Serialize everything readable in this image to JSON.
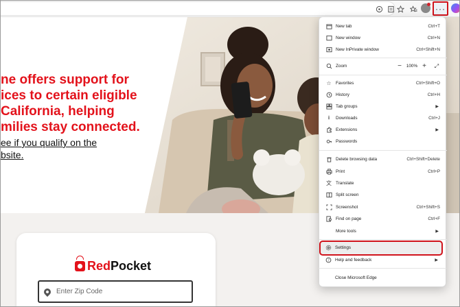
{
  "browser": {
    "toolbar_icons": [
      "location-pin-icon",
      "reading-mode-icon",
      "favorite-star-icon",
      "favorites-collection-icon",
      "profile-icon",
      "more-menu-icon",
      "copilot-icon"
    ],
    "menu_button_label": "···"
  },
  "page": {
    "headline_lines": [
      "ne offers support for",
      "ices to certain eligible",
      "California, helping",
      "milies stay connected."
    ],
    "sub_lines": [
      "ee if you qualify on the",
      "bsite."
    ],
    "brand_red": "Red",
    "brand_black": "Pocket",
    "zip_placeholder": "Enter Zip Code",
    "accent_color": "#e3121b"
  },
  "menu": {
    "items": [
      {
        "label": "New tab",
        "shortcut": "Ctrl+T",
        "icon": "new-tab-icon"
      },
      {
        "label": "New window",
        "shortcut": "Ctrl+N",
        "icon": "new-window-icon"
      },
      {
        "label": "New InPrivate window",
        "shortcut": "Ctrl+Shift+N",
        "icon": "inprivate-icon"
      },
      {
        "label": "Zoom",
        "icon": "zoom-icon",
        "zoom_value": "100%"
      },
      {
        "label": "Favorites",
        "shortcut": "Ctrl+Shift+O",
        "icon": "favorites-icon"
      },
      {
        "label": "History",
        "shortcut": "Ctrl+H",
        "icon": "history-icon"
      },
      {
        "label": "Tab groups",
        "icon": "tab-groups-icon"
      },
      {
        "label": "Downloads",
        "shortcut": "Ctrl+J",
        "icon": "downloads-icon"
      },
      {
        "label": "Extensions",
        "icon": "extensions-icon"
      },
      {
        "label": "Passwords",
        "icon": "passwords-icon"
      },
      {
        "label": "Delete browsing data",
        "shortcut": "Ctrl+Shift+Delete",
        "icon": "delete-data-icon"
      },
      {
        "label": "Print",
        "shortcut": "Ctrl+P",
        "icon": "print-icon"
      },
      {
        "label": "Translate",
        "icon": "translate-icon"
      },
      {
        "label": "Split screen",
        "icon": "split-screen-icon"
      },
      {
        "label": "Screenshot",
        "shortcut": "Ctrl+Shift+S",
        "icon": "screenshot-icon"
      },
      {
        "label": "Find on page",
        "shortcut": "Ctrl+F",
        "icon": "find-icon"
      },
      {
        "label": "More tools",
        "icon": "more-tools-icon"
      },
      {
        "label": "Settings",
        "icon": "settings-icon"
      },
      {
        "label": "Help and feedback",
        "icon": "help-icon"
      },
      {
        "label": "Close Microsoft Edge"
      }
    ],
    "highlight_color": "#d0121b"
  }
}
